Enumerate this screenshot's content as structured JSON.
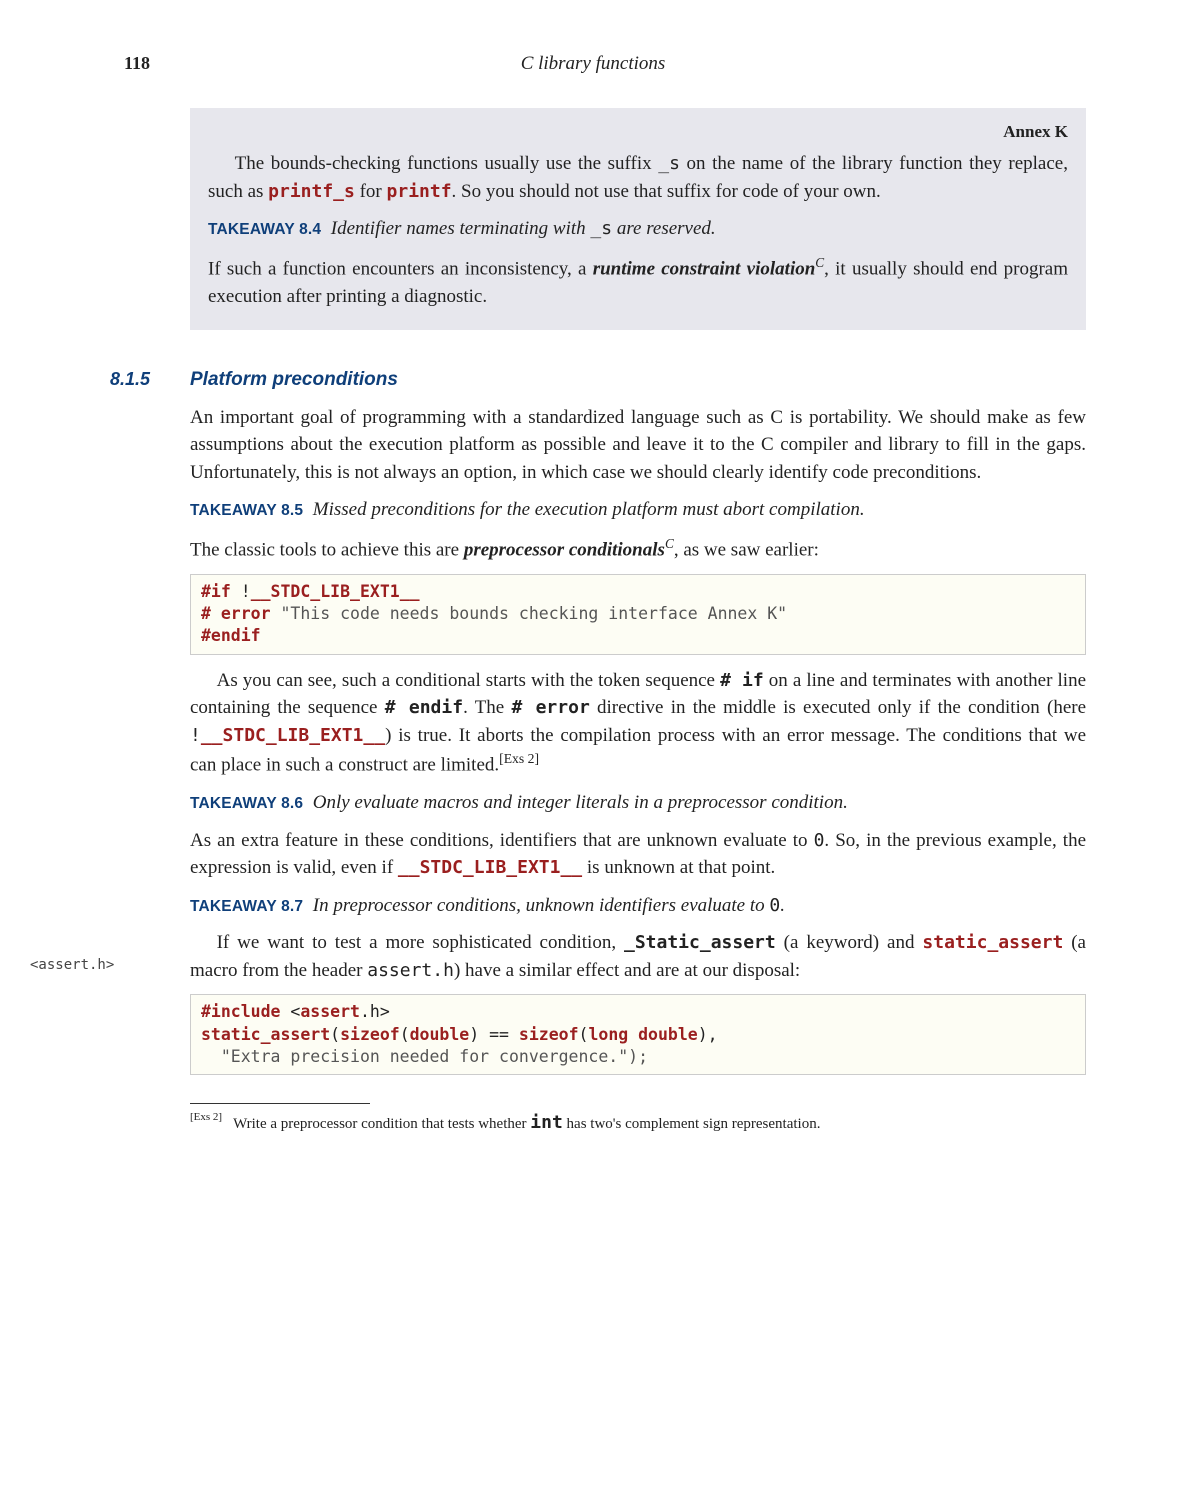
{
  "page": {
    "number": "118",
    "chapter_title": "C library functions"
  },
  "shaded": {
    "annex": "Annex K",
    "p1_a": "The bounds-checking functions usually use the suffix ",
    "p1_code1": "_s",
    "p1_b": " on the name of the library function they replace, such as ",
    "p1_code2": "printf_s",
    "p1_c": " for ",
    "p1_code3": "printf",
    "p1_d": ". So you should not use that suffix for code of your own.",
    "takeaway84_label": "TAKEAWAY 8.4",
    "takeaway84_a": "Identifier names terminating with ",
    "takeaway84_code": "_s",
    "takeaway84_b": " are reserved.",
    "p2_a": "If such a function encounters an inconsistency, a ",
    "p2_term": "runtime constraint violation",
    "p2_sup": "C",
    "p2_b": ", it usually should end program execution after printing a diagnostic."
  },
  "section": {
    "num": "8.1.5",
    "title": "Platform preconditions"
  },
  "p3": "An important goal of programming with a standardized language such as C is portability. We should make as few assumptions about the execution platform as possible and leave it to the C compiler and library to fill in the gaps. Unfortunately, this is not always an option, in which case we should clearly identify code preconditions.",
  "takeaway85_label": "TAKEAWAY 8.5",
  "takeaway85_text": "Missed preconditions for the execution platform must abort compilation.",
  "p4_a": "The classic tools to achieve this are ",
  "p4_term": "preprocessor conditionals",
  "p4_sup": "C",
  "p4_b": ", as we saw earlier:",
  "code1": {
    "l1_kw": "#if",
    "l1_rest_a": " !",
    "l1_rest_kw": "__STDC_LIB_EXT1__",
    "l2_kw": "# error",
    "l2_str": " \"This code needs bounds checking interface Annex K\"",
    "l3_kw": "#endif"
  },
  "p5_a": "As you can see, such a conditional starts with the token sequence ",
  "p5_code1": "# if",
  "p5_b": " on a line and terminates with another line containing the sequence ",
  "p5_code2": "# endif",
  "p5_c": ". The ",
  "p5_code3": "# error",
  "p5_d": " directive in the middle is executed only if the condition (here ",
  "p5_bang": "!",
  "p5_code4": "__STDC_LIB_EXT1__",
  "p5_e": ") is true. It aborts the compilation process with an error message. The conditions that we can place in such a construct are limited.",
  "p5_fn": "[Exs 2]",
  "takeaway86_label": "TAKEAWAY 8.6",
  "takeaway86_text": "Only evaluate macros and integer literals in a preprocessor condition.",
  "p6_a": "As an extra feature in these conditions, identifiers that are unknown evaluate to ",
  "p6_code1": "0",
  "p6_b": ". So, in the previous example, the expression is valid, even if ",
  "p6_code2": "__STDC_LIB_EXT1__",
  "p6_c": " is unknown at that point.",
  "takeaway87_label": "TAKEAWAY 8.7",
  "takeaway87_a": "In preprocessor conditions, unknown identifiers evaluate to ",
  "takeaway87_code": "0",
  "takeaway87_b": ".",
  "margin_note": "<assert.h>",
  "p7_a": "If we want to test a more sophisticated condition, ",
  "p7_code1": "_Static_assert",
  "p7_b": " (a keyword) and ",
  "p7_code2": "static_assert",
  "p7_c": " (a macro from the header ",
  "p7_code3": "assert.h",
  "p7_d": ") have a similar effect and are at our disposal:",
  "code2": {
    "l1_kw1": "#include",
    "l1_a": " <",
    "l1_kw2": "assert",
    "l1_b": ".h>",
    "l2_kw1": "static_assert",
    "l2_a": "(",
    "l2_kw2": "sizeof",
    "l2_b": "(",
    "l2_kw3": "double",
    "l2_c": ") == ",
    "l2_kw4": "sizeof",
    "l2_d": "(",
    "l2_kw5": "long double",
    "l2_e": "),",
    "l3": "  \"Extra precision needed for convergence.\");"
  },
  "footnote_label": "[Exs 2]",
  "footnote_a": "Write a preprocessor condition that tests whether ",
  "footnote_code": "int",
  "footnote_b": " has two's complement sign representation."
}
